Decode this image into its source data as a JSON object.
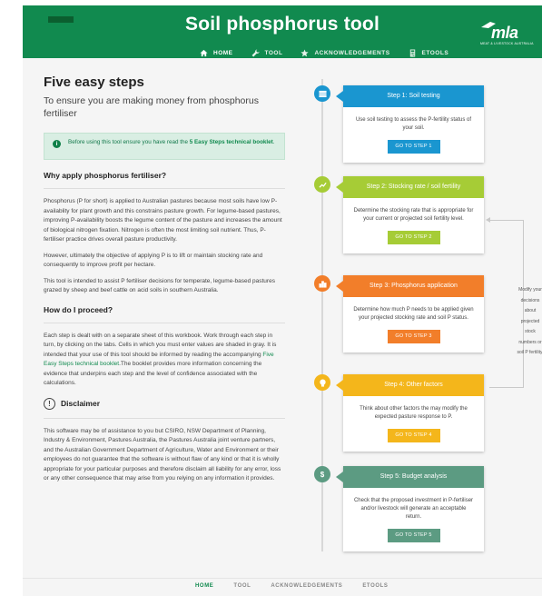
{
  "header": {
    "title": "Soil phosphorus tool",
    "nav": [
      {
        "label": "HOME",
        "icon": "home-icon",
        "active": true
      },
      {
        "label": "TOOL",
        "icon": "wrench-icon",
        "active": false
      },
      {
        "label": "ACKNOWLEDGEMENTS",
        "icon": "star-icon",
        "active": false
      },
      {
        "label": "ETOOLS",
        "icon": "calculator-icon",
        "active": false
      }
    ],
    "logo": {
      "text": "mla",
      "subtitle": "MEAT & LIVESTOCK AUSTRALIA"
    }
  },
  "main": {
    "title": "Five easy steps",
    "subtitle": "To ensure you are making money from phosphorus fertiliser",
    "alert": {
      "icon": "info-icon",
      "text_before": "Before using this tool ensure you have read the ",
      "link": "5 Easy Steps technical booklet",
      "text_after": "."
    },
    "why": {
      "heading": "Why apply phosphorus fertiliser?",
      "p1": "Phosphorus (P for short) is applied to Australian pastures because most soils have low P-availablity for plant growth and this constrains pasture growth. For legume-based pastures, improving P-availability boosts the legume content of the pasture and increases the amount of biological nitrogen fixation. Nitrogen is often the most limiting soil nutrient. Thus, P-fertiliser practice drives overall pasture productivity.",
      "p2": "However, ultimately the objective of applying P is to lift or maintain stocking rate and consequently to improve profit per hectare.",
      "p3": "This tool is intended to assist P fertiliser decisions for temperate, legume-based pastures grazed by sheep and beef cattle on acid soils in southern Australia."
    },
    "how": {
      "heading": "How do I proceed?",
      "p1_before": "Each step is dealt with on a separate sheet of this workbook. Work through each step in turn, by clicking on the tabs. Cells in which you must enter values are shaded in gray. It is intended that your use of this tool should be informed by reading the accompanying ",
      "p1_link": "Five Easy Steps technical booklet",
      "p1_after": ".The booklet provides more information concerning the evidence that underpins each step and the level of confidence associated with the calculations."
    },
    "disclaimer": {
      "heading": "Disclaimer",
      "icon": "exclamation-icon",
      "text": "This software may be of assistance to you but CSIRO, NSW Department of Planning, Industry & Environment, Pastures Australia, the Pastures Australia joint venture partners, and the Australian Government Department of Agriculture, Water and Environment or their employees do not guarantee that the software is without flaw of any kind or that it is wholly appropriate for your particular purposes and therefore disclaim all liability for any error, loss or any other consequence that may arise from you relying on any information it provides."
    }
  },
  "steps": [
    {
      "title": "Step 1: Soil testing",
      "desc": "Use soil testing to assess the P-fertility status of your soil.",
      "button": "GO TO STEP 1",
      "color": "#1a96d0",
      "icon": "list-icon"
    },
    {
      "title": "Step 2: Stocking rate / soil fertility",
      "desc": "Determine the stocking rate that is appropriate for your current or projected soil fertility level.",
      "button": "GO TO STEP 2",
      "color": "#a6cc36",
      "icon": "trend-icon"
    },
    {
      "title": "Step 3: Phosphorus application",
      "desc": "Determine how much P needs to be applied given your projected stocking rate and soil P status.",
      "button": "GO TO STEP 3",
      "color": "#f27e2a",
      "icon": "bar-chart-icon"
    },
    {
      "title": "Step 4: Other factors",
      "desc": "Think about other factors the may modify the expected pasture response to P.",
      "button": "GO TO STEP 4",
      "color": "#f4b61b",
      "icon": "bulb-icon"
    },
    {
      "title": "Step 5: Budget analysis",
      "desc": "Check that the proposed investment in P-fertiliser and/or livestock will generate an acceptable return.",
      "button": "GO TO STEP 5",
      "color": "#5c9b82",
      "icon": "dollar-icon"
    }
  ],
  "side_note": "Modify your decisions about projected stock numbers or soil P fertility.",
  "footer": {
    "nav": [
      "HOME",
      "TOOL",
      "ACKNOWLEDGEMENTS",
      "ETOOLS"
    ]
  }
}
